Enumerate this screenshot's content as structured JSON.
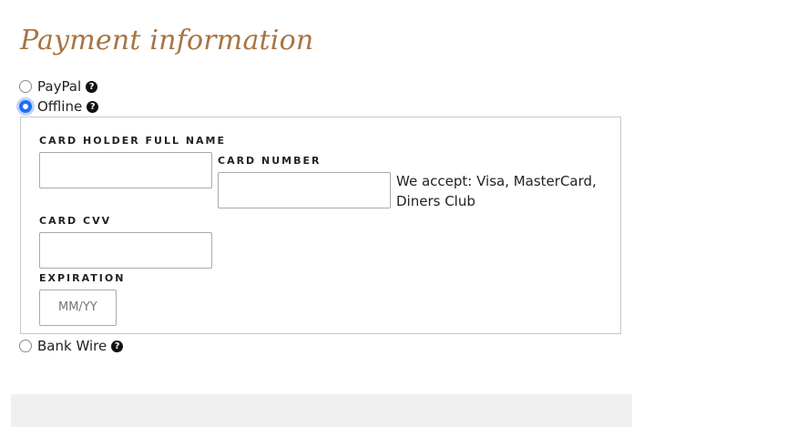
{
  "page": {
    "title": "Payment information"
  },
  "payment_methods": [
    {
      "label": "PayPal",
      "selected": false,
      "help_icon": "question-circle-icon"
    },
    {
      "label": "Offline",
      "selected": true,
      "help_icon": "question-circle-icon"
    },
    {
      "label": "Bank Wire",
      "selected": false,
      "help_icon": "question-circle-icon"
    }
  ],
  "offline_form": {
    "card_holder": {
      "label": "CARD HOLDER FULL NAME",
      "value": ""
    },
    "card_number": {
      "label": "CARD NUMBER",
      "value": ""
    },
    "accepted_cards": "We accept: Visa, MasterCard, Diners Club",
    "card_cvv": {
      "label": "CARD CVV",
      "value": ""
    },
    "expiration": {
      "label": "EXPIRATION",
      "placeholder": "MM/YY",
      "value": ""
    }
  },
  "colors": {
    "title": "#a87442",
    "radio_selected": "#1f6ff2",
    "border": "#c8c8c8",
    "footer_panel": "#f0f0f0"
  }
}
